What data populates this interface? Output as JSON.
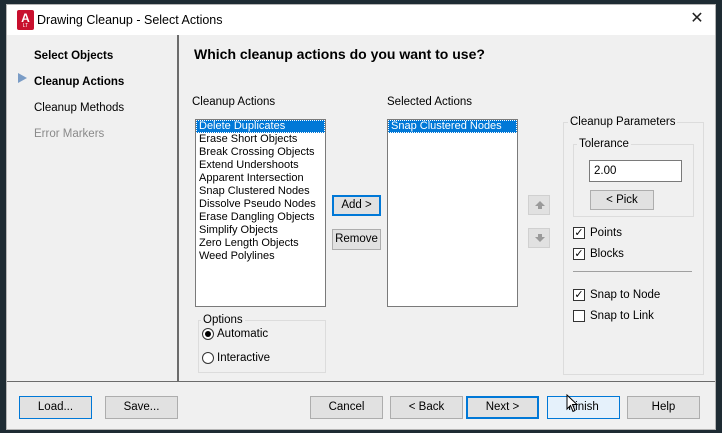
{
  "window": {
    "title": "Drawing Cleanup - Select Actions",
    "app_icon_letter": "A",
    "app_icon_sub": "LT"
  },
  "sidebar": {
    "items": [
      {
        "label": "Select Objects",
        "state": "normal"
      },
      {
        "label": "Cleanup Actions",
        "state": "current"
      },
      {
        "label": "Cleanup Methods",
        "state": "normal"
      },
      {
        "label": "Error Markers",
        "state": "disabled"
      }
    ]
  },
  "main": {
    "heading": "Which cleanup actions do you want to use?",
    "cleanup_actions_label": "Cleanup Actions",
    "cleanup_actions": [
      "Delete Duplicates",
      "Erase Short Objects",
      "Break Crossing Objects",
      "Extend Undershoots",
      "Apparent Intersection",
      "Snap Clustered Nodes",
      "Dissolve Pseudo Nodes",
      "Erase Dangling Objects",
      "Simplify Objects",
      "Zero Length Objects",
      "Weed Polylines"
    ],
    "cleanup_actions_selected": "Delete Duplicates",
    "selected_actions_label": "Selected Actions",
    "selected_actions": [
      "Snap Clustered Nodes"
    ],
    "add_button": "Add >",
    "remove_button": "Remove",
    "options": {
      "title": "Options",
      "automatic_label": "Automatic",
      "interactive_label": "Interactive",
      "selected": "Automatic"
    },
    "parameters": {
      "title": "Cleanup Parameters",
      "tolerance_title": "Tolerance",
      "tolerance_value": "2.00",
      "pick_button": "< Pick",
      "points_label": "Points",
      "points_checked": true,
      "blocks_label": "Blocks",
      "blocks_checked": true,
      "snap_to_node_label": "Snap to Node",
      "snap_to_node_checked": true,
      "snap_to_link_label": "Snap to Link",
      "snap_to_link_checked": false
    }
  },
  "footer": {
    "load": "Load...",
    "save": "Save...",
    "cancel": "Cancel",
    "back": "< Back",
    "next": "Next >",
    "finish": "Finish",
    "help": "Help"
  },
  "colors": {
    "selection": "#0078d7",
    "brand": "#c8102e"
  }
}
